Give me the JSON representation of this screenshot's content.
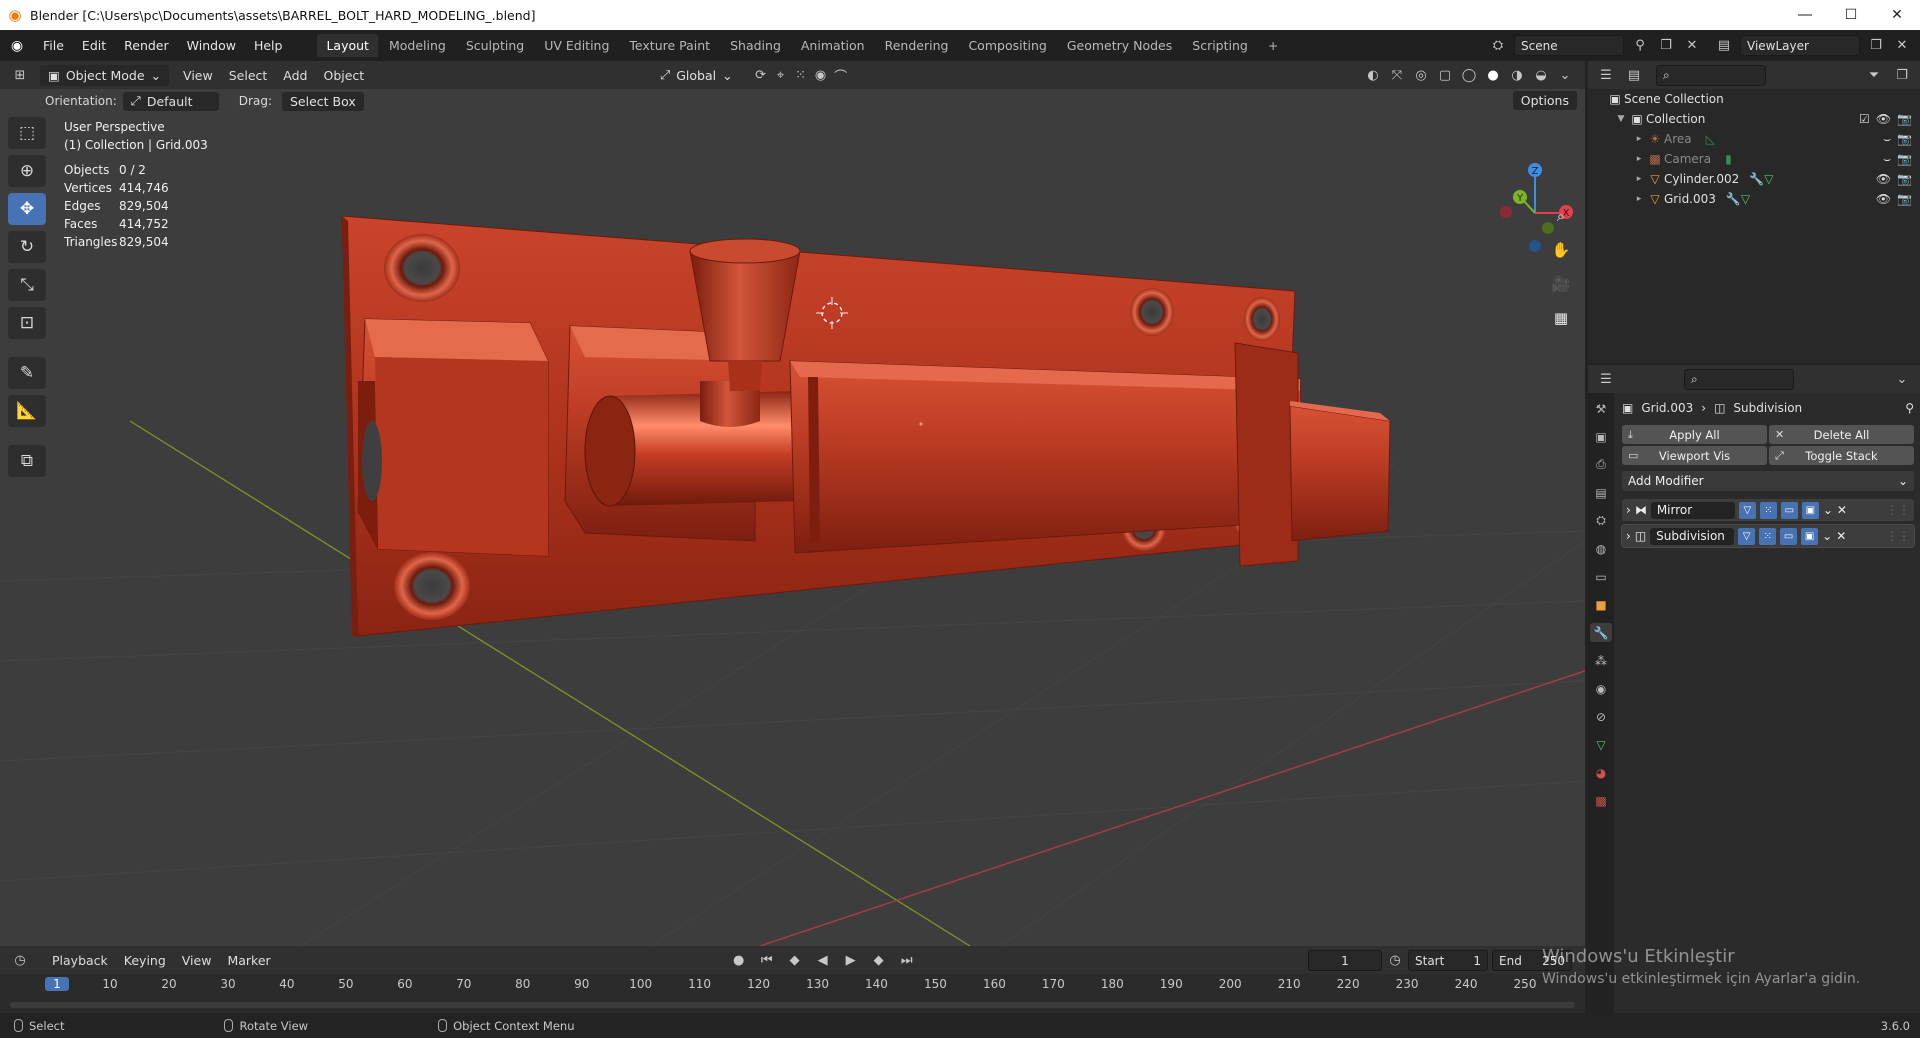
{
  "window": {
    "title": "Blender [C:\\Users\\pc\\Documents\\assets\\BARREL_BOLT_HARD_MODELING_.blend]"
  },
  "menu": [
    "File",
    "Edit",
    "Render",
    "Window",
    "Help"
  ],
  "workspaces": [
    "Layout",
    "Modeling",
    "Sculpting",
    "UV Editing",
    "Texture Paint",
    "Shading",
    "Animation",
    "Rendering",
    "Compositing",
    "Geometry Nodes",
    "Scripting"
  ],
  "active_workspace": "Layout",
  "scene_name": "Scene",
  "view_layer": "ViewLayer",
  "viewport": {
    "mode": "Object Mode",
    "menus": [
      "View",
      "Select",
      "Add",
      "Object"
    ],
    "transform_orientation": "Global",
    "orientation_label": "Orientation:",
    "orientation_value": "Default",
    "drag_label": "Drag:",
    "drag_value": "Select Box",
    "options_label": "Options",
    "perspective": "User Perspective",
    "collection_info": "(1) Collection | Grid.003",
    "stats": [
      {
        "label": "Objects",
        "value": "0 / 2"
      },
      {
        "label": "Vertices",
        "value": "414,746"
      },
      {
        "label": "Edges",
        "value": "829,504"
      },
      {
        "label": "Faces",
        "value": "414,752"
      },
      {
        "label": "Triangles",
        "value": "829,504"
      }
    ],
    "gizmo_axes": {
      "x": "X",
      "y": "Y",
      "z": "Z"
    }
  },
  "outliner": {
    "root": "Scene Collection",
    "collection": "Collection",
    "items": [
      {
        "name": "Area",
        "dim": true
      },
      {
        "name": "Camera",
        "dim": true
      },
      {
        "name": "Cylinder.002",
        "dim": false
      },
      {
        "name": "Grid.003",
        "dim": false
      }
    ]
  },
  "properties": {
    "object": "Grid.003",
    "modifier": "Subdivision",
    "buttons": [
      "Apply All",
      "Delete All",
      "Viewport Vis",
      "Toggle Stack"
    ],
    "add_modifier": "Add Modifier",
    "modifiers": [
      "Mirror",
      "Subdivision"
    ]
  },
  "timeline": {
    "menus": [
      "Playback",
      "Keying",
      "View",
      "Marker"
    ],
    "current_frame": "1",
    "start_label": "Start",
    "start": "1",
    "end_label": "End",
    "end": "250",
    "ticks": [
      "1",
      "10",
      "20",
      "30",
      "40",
      "50",
      "60",
      "70",
      "80",
      "90",
      "100",
      "110",
      "120",
      "130",
      "140",
      "150",
      "160",
      "170",
      "180",
      "190",
      "200",
      "210",
      "220",
      "230",
      "240",
      "250"
    ]
  },
  "statusbar": {
    "select": "Select",
    "rotate": "Rotate View",
    "context": "Object Context Menu",
    "version": "3.6.0"
  },
  "watermark": {
    "line1": "Windows'u Etkinleştir",
    "line2": "Windows'u etkinleştirmek için Ayarlar'a gidin."
  },
  "colors": {
    "accent": "#4772b3",
    "model": "#b8361f",
    "axis_x": "#e0404f",
    "axis_y": "#7db526",
    "axis_z": "#3f8ee0"
  }
}
